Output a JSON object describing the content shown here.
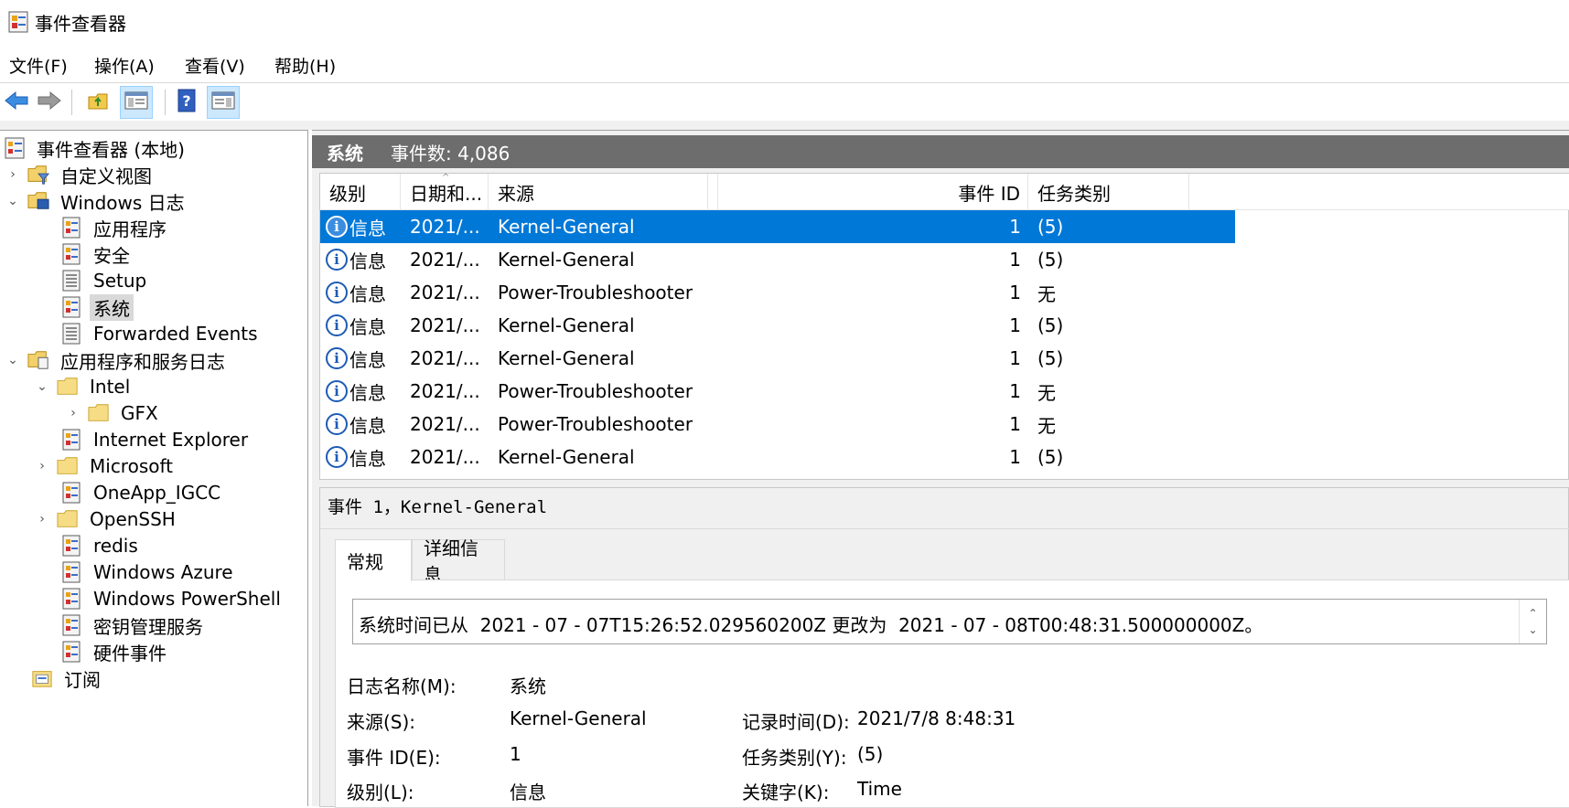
{
  "window": {
    "title": "事件查看器",
    "app_icon": "event-viewer-icon"
  },
  "menu": [
    "文件(F)",
    "操作(A)",
    "查看(V)",
    "帮助(H)"
  ],
  "toolbar": {
    "buttons": [
      {
        "name": "back-arrow-icon"
      },
      {
        "name": "forward-arrow-icon"
      },
      {
        "name": "up-folder-icon"
      },
      {
        "name": "show-hide-tree-icon"
      },
      {
        "name": "help-icon"
      },
      {
        "name": "show-hide-action-pane-icon"
      }
    ]
  },
  "tree": {
    "root": "事件查看器 (本地)",
    "custom_views": "自定义视图",
    "windows_logs": "Windows 日志",
    "windows_logs_items": [
      "应用程序",
      "安全",
      "Setup",
      "系统",
      "Forwarded Events"
    ],
    "app_service_logs": "应用程序和服务日志",
    "intel": "Intel",
    "gfx": "GFX",
    "app_service_items": [
      "Internet Explorer",
      "Microsoft",
      "OneApp_IGCC",
      "OpenSSH",
      "redis",
      "Windows Azure",
      "Windows PowerShell",
      "密钥管理服务",
      "硬件事件"
    ],
    "subscriptions": "订阅"
  },
  "panel": {
    "title": "系统",
    "count": "事件数: 4,086"
  },
  "grid": {
    "columns": [
      "级别",
      "日期和...",
      "来源",
      "事件 ID",
      "任务类别"
    ],
    "rows": [
      {
        "level": "信息",
        "date": "2021/...",
        "source": "Kernel-General",
        "event_id": "1",
        "category": "(5)"
      },
      {
        "level": "信息",
        "date": "2021/...",
        "source": "Kernel-General",
        "event_id": "1",
        "category": "(5)"
      },
      {
        "level": "信息",
        "date": "2021/...",
        "source": "Power-Troubleshooter",
        "event_id": "1",
        "category": "无"
      },
      {
        "level": "信息",
        "date": "2021/...",
        "source": "Kernel-General",
        "event_id": "1",
        "category": "(5)"
      },
      {
        "level": "信息",
        "date": "2021/...",
        "source": "Kernel-General",
        "event_id": "1",
        "category": "(5)"
      },
      {
        "level": "信息",
        "date": "2021/...",
        "source": "Power-Troubleshooter",
        "event_id": "1",
        "category": "无"
      },
      {
        "level": "信息",
        "date": "2021/...",
        "source": "Power-Troubleshooter",
        "event_id": "1",
        "category": "无"
      },
      {
        "level": "信息",
        "date": "2021/...",
        "source": "Kernel-General",
        "event_id": "1",
        "category": "(5)"
      }
    ]
  },
  "detail": {
    "title": "事件 1，Kernel-General",
    "tabs": [
      "常规",
      "详细信息"
    ],
    "message": "系统时间已从  2021 - 07 - 07T15:26:52.029560200Z 更改为  2021 - 07 - 08T00:48:31.500000000Z。",
    "props": {
      "log_name_label": "日志名称(M):",
      "log_name": "系统",
      "source_label": "来源(S):",
      "source": "Kernel-General",
      "logged_label": "记录时间(D):",
      "logged": "2021/7/8 8:48:31",
      "event_id_label": "事件 ID(E):",
      "event_id": "1",
      "category_label": "任务类别(Y):",
      "category": "(5)",
      "level_label": "级别(L):",
      "level": "信息",
      "keywords_label": "关键字(K):",
      "keywords": "Time"
    }
  }
}
